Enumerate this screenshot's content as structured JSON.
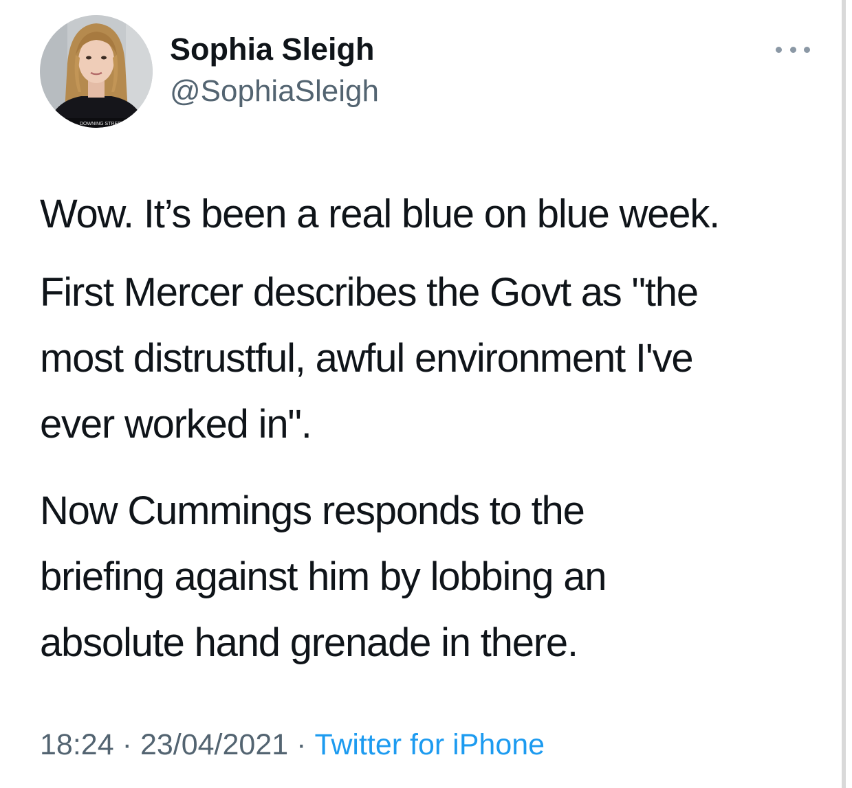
{
  "author": {
    "display_name": "Sophia Sleigh",
    "handle": "@SophiaSleigh",
    "avatar_caption": "DOWNING STREET"
  },
  "tweet": {
    "lines": {
      "p1": [
        "Wow. It’s been a real blue on blue week."
      ],
      "p2": [
        "First Mercer describes the Govt as \"the",
        "most distrustful, awful environment I've",
        "ever worked in\"."
      ],
      "p3": [
        "Now Cummings responds to the",
        "briefing against him by lobbing an",
        "absolute hand grenade in there."
      ]
    },
    "time": "18:24",
    "date": "23/04/2021",
    "separator": "·",
    "source": "Twitter for iPhone"
  },
  "icons": {
    "more": "more-horizontal-icon",
    "avatar": "profile-photo"
  },
  "colors": {
    "text": "#0f1419",
    "secondary": "#536471",
    "link": "#1d9bf0"
  }
}
